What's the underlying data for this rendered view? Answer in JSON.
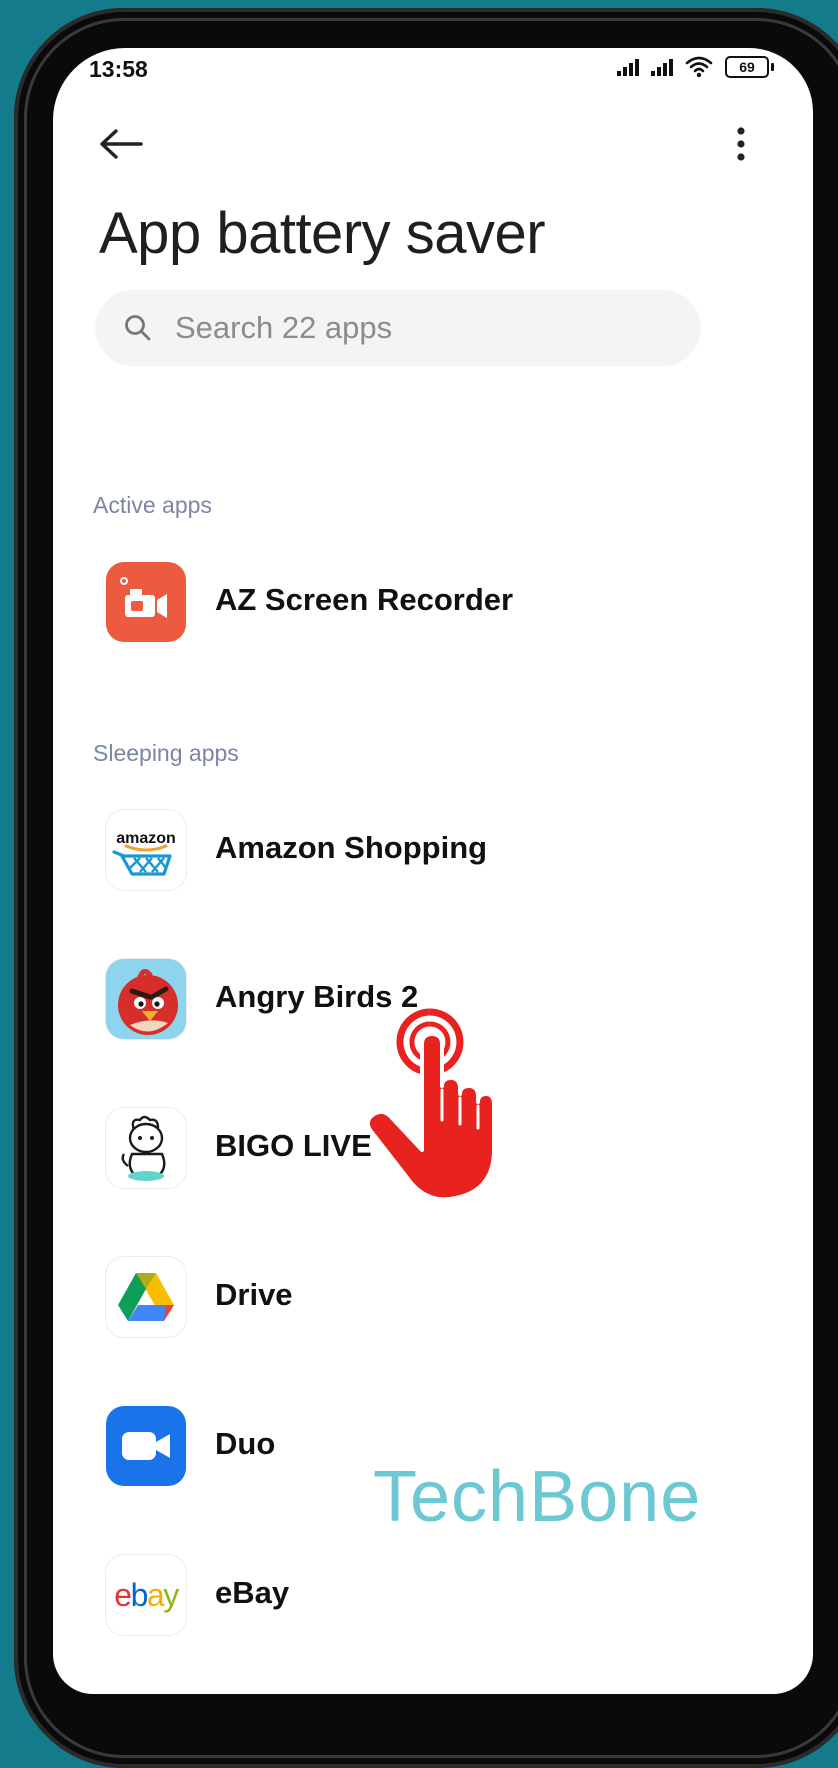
{
  "status_bar": {
    "time": "13:58",
    "battery": "69"
  },
  "header": {
    "title": "App battery saver"
  },
  "search": {
    "placeholder": "Search 22 apps"
  },
  "sections": {
    "active_label": "Active apps",
    "sleeping_label": "Sleeping apps"
  },
  "active_apps": [
    {
      "name": "AZ Screen Recorder",
      "icon": "az-recorder-icon",
      "color": "#ec5a3f"
    }
  ],
  "sleeping_apps": [
    {
      "name": "Amazon Shopping",
      "icon": "amazon-icon",
      "logo_text": "amazon"
    },
    {
      "name": "Angry Birds 2",
      "icon": "angry-birds-icon"
    },
    {
      "name": "BIGO LIVE",
      "icon": "bigo-live-icon"
    },
    {
      "name": "Drive",
      "icon": "google-drive-icon"
    },
    {
      "name": "Duo",
      "icon": "duo-icon",
      "color": "#1a73e8"
    },
    {
      "name": "eBay",
      "icon": "ebay-icon",
      "logo_text": "ebay"
    }
  ],
  "watermark": "TechBone",
  "colors": {
    "background": "#147b8b",
    "section_label": "#7b86a4",
    "pointer": "#e8221e",
    "watermark": "#6cc8d3"
  }
}
